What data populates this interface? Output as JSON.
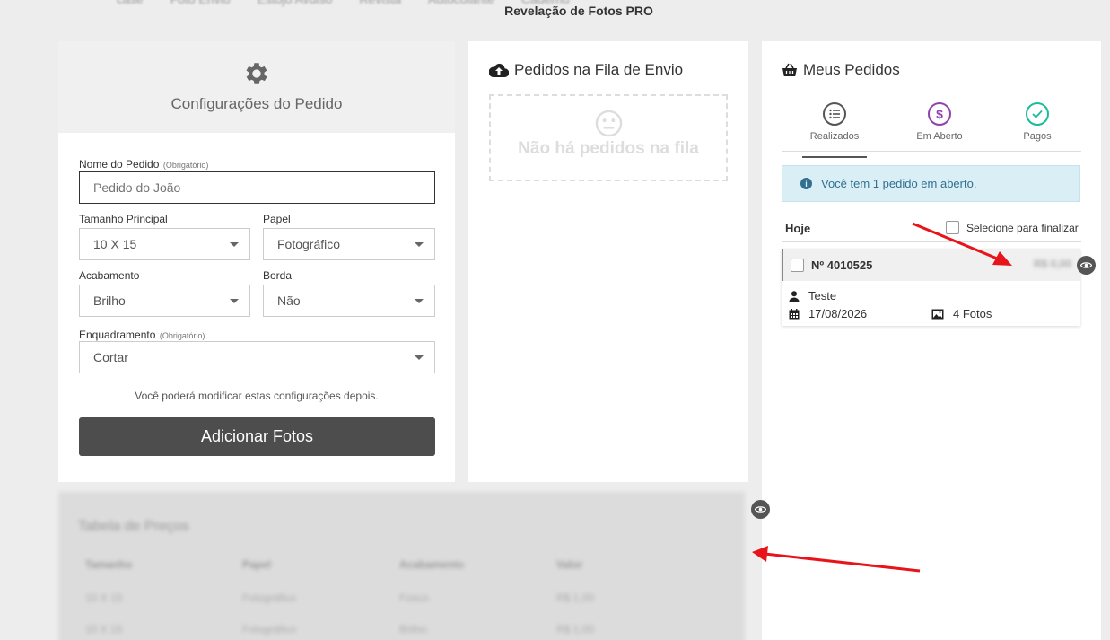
{
  "topnav": [
    "case",
    "Foto Envio",
    "Estojo Avulso",
    "Revista",
    "Autocolante",
    "Caderno"
  ],
  "page_subtitle": "Revelação de Fotos PRO",
  "config": {
    "title": "Configurações do Pedido",
    "order_name_label": "Nome do Pedido",
    "required_tag": "(Obrigatório)",
    "order_name_placeholder": "Pedido do João",
    "size_label": "Tamanho Principal",
    "size_value": "10 X 15",
    "paper_label": "Papel",
    "paper_value": "Fotográfico",
    "finish_label": "Acabamento",
    "finish_value": "Brilho",
    "border_label": "Borda",
    "border_value": "Não",
    "framing_label": "Enquadramento",
    "framing_value": "Cortar",
    "hint": "Você poderá modificar estas configurações depois.",
    "add_button": "Adicionar Fotos"
  },
  "queue": {
    "title": "Pedidos na Fila de Envio",
    "empty_text": "Não há pedidos na fila"
  },
  "orders": {
    "title": "Meus Pedidos",
    "tabs": [
      {
        "label": "Realizados",
        "icon": "list-icon",
        "color": "#555555"
      },
      {
        "label": "Em Aberto",
        "icon": "dollar-icon",
        "color": "#8e44ad"
      },
      {
        "label": "Pagos",
        "icon": "check-icon",
        "color": "#1abc9c"
      }
    ],
    "alert": "Você tem 1 pedido em aberto.",
    "today_label": "Hoje",
    "select_all_label": "Selecione para finalizar",
    "order_number": "Nº 4010525",
    "order_price": "R$ 0,00",
    "order_name": "Teste",
    "order_date": "17/08/2026",
    "order_photos": "4 Fotos"
  },
  "price_table": {
    "title": "Tabela de Preços",
    "headers": [
      "Tamanho",
      "Papel",
      "Acabamento",
      "Valor"
    ],
    "rows": [
      [
        "10 X 15",
        "Fotográfico",
        "Fosco",
        "R$ 1,00"
      ],
      [
        "10 X 15",
        "Fotográfico",
        "Brilho",
        "R$ 1,00"
      ]
    ]
  },
  "colors": {
    "accent": "#4d4d4d",
    "annotation_arrow": "#e8141b",
    "info_bg": "#d9eef5"
  }
}
